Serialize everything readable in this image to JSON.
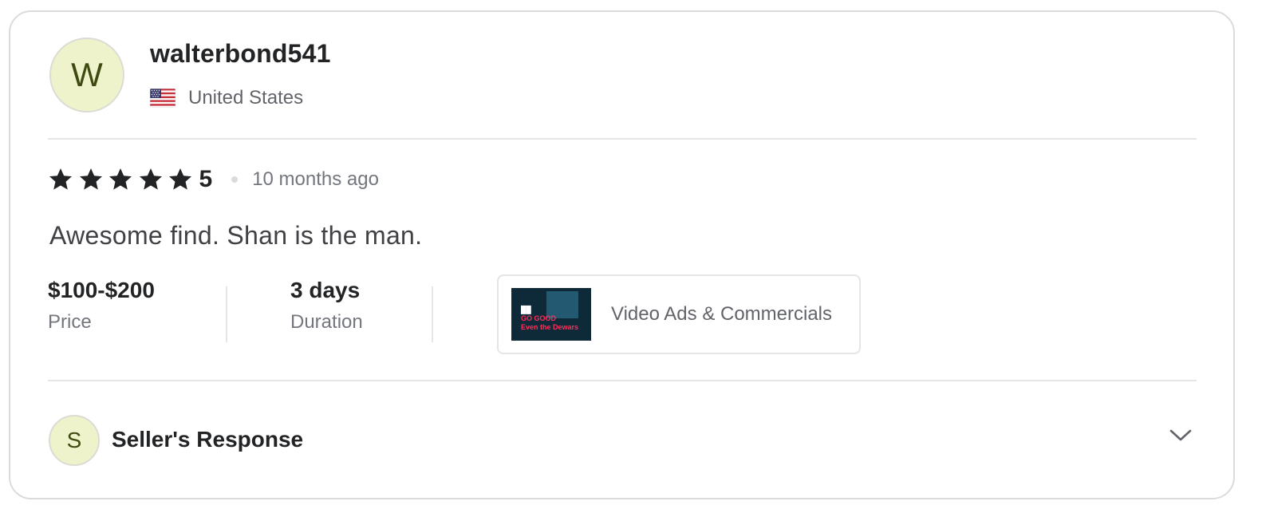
{
  "reviewer": {
    "initial": "W",
    "username": "walterbond541",
    "country": "United States",
    "flag_icon": "us-flag-icon"
  },
  "review": {
    "rating": "5",
    "stars": 5,
    "time_ago": "10 months ago",
    "text": "Awesome find. Shan is the man."
  },
  "meta": {
    "price_value": "$100-$200",
    "price_label": "Price",
    "duration_value": "3 days",
    "duration_label": "Duration"
  },
  "gig": {
    "title": "Video Ads & Commercials",
    "thumb_lines": [
      "██",
      "GO GOOD",
      "Even the Dewars"
    ]
  },
  "seller_response": {
    "initial": "S",
    "title": "Seller's Response",
    "expand_icon": "chevron-down-icon"
  },
  "colors": {
    "avatar_bg": "#eef3cc",
    "avatar_text": "#3f4a10",
    "star": "#222325",
    "border": "#dadbdd"
  }
}
